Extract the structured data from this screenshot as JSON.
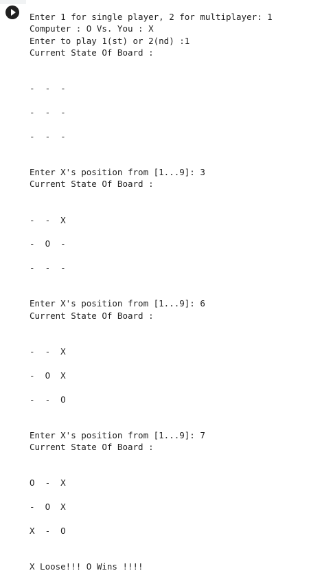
{
  "run_button": {
    "icon": "play-icon"
  },
  "output_lines": [
    "Enter 1 for single player, 2 for multiplayer: 1",
    "Computer : O Vs. You : X",
    "Enter to play 1(st) or 2(nd) :1",
    "Current State Of Board :",
    "",
    "",
    "-  -  -",
    "",
    "-  -  -",
    "",
    "-  -  -",
    "",
    "",
    "Enter X's position from [1...9]: 3",
    "Current State Of Board :",
    "",
    "",
    "-  -  X",
    "",
    "-  O  -",
    "",
    "-  -  -",
    "",
    "",
    "Enter X's position from [1...9]: 6",
    "Current State Of Board :",
    "",
    "",
    "-  -  X",
    "",
    "-  O  X",
    "",
    "-  -  O",
    "",
    "",
    "Enter X's position from [1...9]: 7",
    "Current State Of Board :",
    "",
    "",
    "O  -  X",
    "",
    "-  O  X",
    "",
    "X  -  O",
    "",
    "",
    "X Loose!!! O Wins !!!!"
  ]
}
